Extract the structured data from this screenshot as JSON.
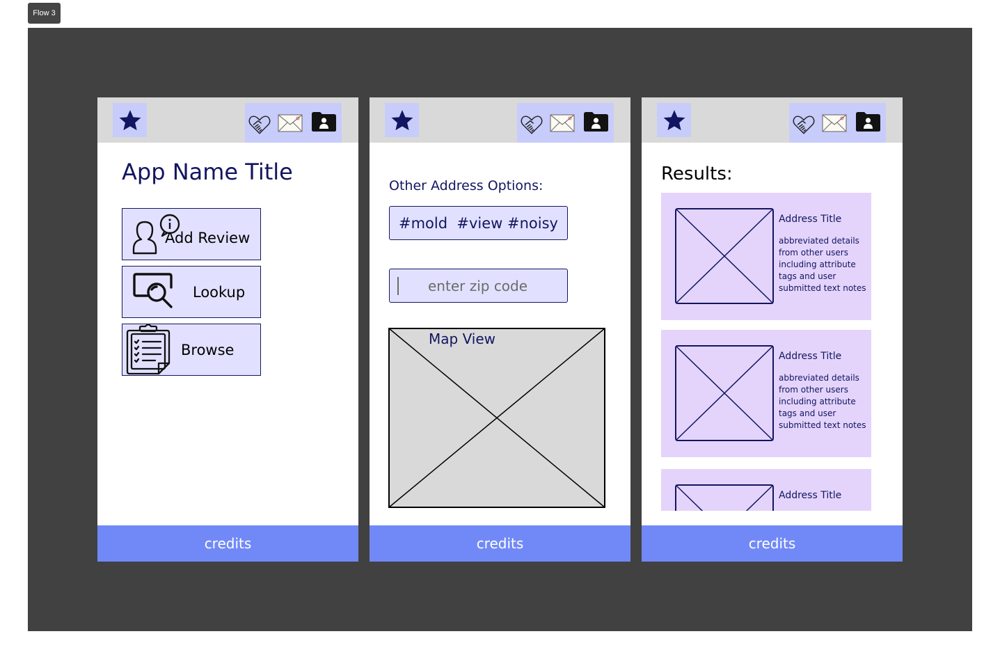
{
  "flow": {
    "label": "Flow 3"
  },
  "colors": {
    "canvas": "#414141",
    "topbar": "#d9d9d9",
    "icon_box": "#c8ccfa",
    "button_fill": "#e1e1ff",
    "card_fill": "#e4d4fb",
    "credits_bar": "#7189f7",
    "navy": "#121560"
  },
  "header": {
    "icons": [
      "star-icon",
      "handshake-heart-icon",
      "envelope-icon",
      "contact-folder-icon"
    ]
  },
  "footer": {
    "label": "credits"
  },
  "screen1": {
    "title": "App Name Title",
    "buttons": [
      {
        "label": "Add Review",
        "icon": "user-info-icon"
      },
      {
        "label": "Lookup",
        "icon": "search-screen-icon"
      },
      {
        "label": "Browse",
        "icon": "clipboard-list-icon"
      }
    ]
  },
  "screen2": {
    "heading": "Other Address Options:",
    "tags": "#mold  #view #noisy",
    "zip_placeholder": "enter zip code",
    "map_label": "Map View"
  },
  "screen3": {
    "title": "Results:",
    "results": [
      {
        "title": "Address Title",
        "details": "abbreviated details from other users including attribute tags and user submitted text notes"
      },
      {
        "title": "Address Title",
        "details": "abbreviated details from other users including attribute tags and user submitted text notes"
      },
      {
        "title": "Address Title",
        "details": ""
      }
    ]
  }
}
